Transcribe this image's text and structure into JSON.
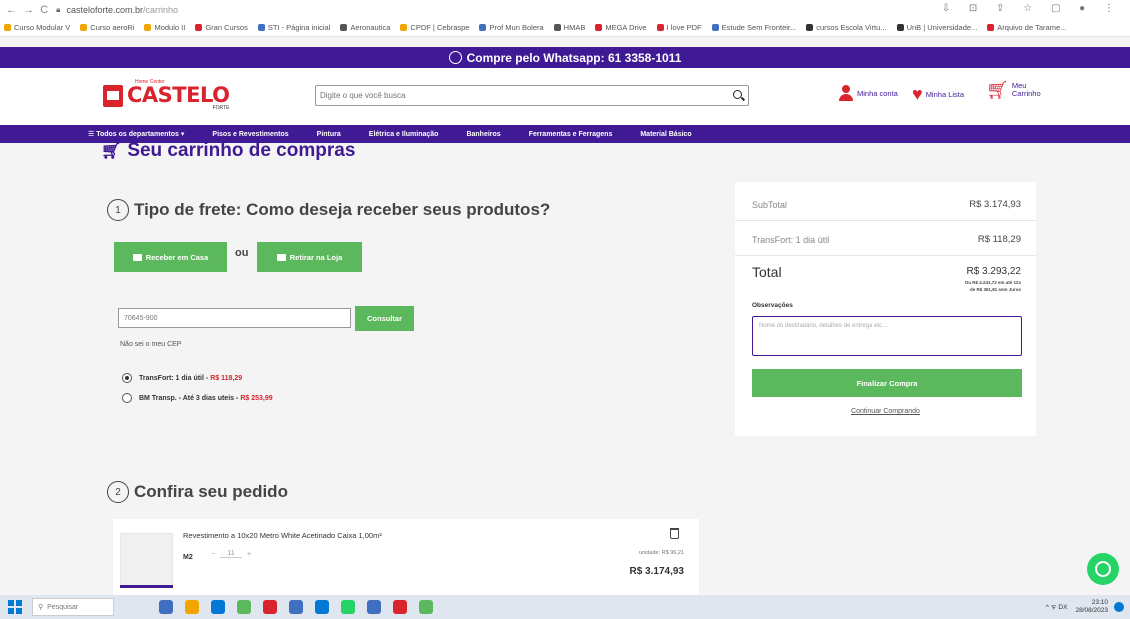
{
  "browser": {
    "url_host": "casteloforte.com.br",
    "url_path": "/carrinho"
  },
  "bookmarks": [
    {
      "label": "Curso Modular V",
      "color": "#f0a500"
    },
    {
      "label": "Curso aeroRi",
      "color": "#f0a500"
    },
    {
      "label": "Modulo II",
      "color": "#f0a500"
    },
    {
      "label": "Gran Cursos",
      "color": "#d9232d"
    },
    {
      "label": "STI - Página inicial",
      "color": "#3f6fbf"
    },
    {
      "label": "Aeronautica",
      "color": "#555555"
    },
    {
      "label": "CPDF | Cebraspe",
      "color": "#f0a500"
    },
    {
      "label": "Prof Mun Bolera",
      "color": "#3f6fbf"
    },
    {
      "label": "HMAB",
      "color": "#555555"
    },
    {
      "label": "MEGA Drive",
      "color": "#d9232d"
    },
    {
      "label": "I love PDF",
      "color": "#d9232d"
    },
    {
      "label": "Estude Sem Fronteir...",
      "color": "#3f6fbf"
    },
    {
      "label": "cursos Escola Virtu...",
      "color": "#333333"
    },
    {
      "label": "UnB | Universidade...",
      "color": "#333333"
    },
    {
      "label": "Arquivo de Tarame...",
      "color": "#d9232d"
    }
  ],
  "banner": {
    "text": "Compre pelo Whatsapp: 61 3358-1011"
  },
  "header": {
    "logo_small": "Home Center",
    "logo_main": "CASTELO",
    "logo_sub": "FORTE",
    "search_placeholder": "Digite o que você busca",
    "account": "Minha conta",
    "wishlist": "Minha Lista",
    "cart_line1": "Meu",
    "cart_line2": "Carrinho"
  },
  "nav": [
    "☰ Todos os departamentos  ▾",
    "Pisos e Revestimentos",
    "Pintura",
    "Elétrica e Iluminação",
    "Banheiros",
    "Ferramentas e Ferragens",
    "Material Básico"
  ],
  "page_title": "Seu carrinho de compras",
  "shipping": {
    "step": "1",
    "title": "Tipo de frete: Como deseja receber seus produtos?",
    "home_btn": "Receber em Casa",
    "or": "ou",
    "store_btn": "Retirar na Loja",
    "cep_value": "70645-900",
    "consult_btn": "Consultar",
    "unknown_cep": "Não sei o meu CEP",
    "options": [
      {
        "label": "TransFort: 1 dia útil - ",
        "price": "R$ 118,29",
        "selected": true
      },
      {
        "label": "BM Transp. - Até 3 dias uteis - ",
        "price": "R$ 253,99",
        "selected": false
      }
    ]
  },
  "summary": {
    "subtotal_label": "SubTotal",
    "subtotal_value": "R$ 3.174,93",
    "shipping_label": "TransFort: 1 dia útil",
    "shipping_value": "R$ 118,29",
    "total_label": "Total",
    "total_value": "R$ 3.293,22",
    "installment_1": "Ou R$ 4.241,72 em até 12x",
    "installment_2": "de R$ 361,81 sem Juros",
    "notes_label": "Observações",
    "notes_placeholder": "Nome do destinatário, detalhes de entrega etc ...",
    "checkout_btn": "Finalizar Compra",
    "continue_link": "Continuar Comprando"
  },
  "order": {
    "step": "2",
    "title": "Confira seu pedido",
    "item": {
      "name": "Revestimento a 10x20 Metro White Acetinado Caixa 1,00m²",
      "unit": "M2",
      "minus": "−",
      "qty": "11",
      "plus": "+",
      "unit_price": "unidade: R$ 96,21",
      "total": "R$ 3.174,93"
    }
  },
  "taskbar": {
    "search": "Pesquisar",
    "tray": "^ ᯤ DX",
    "time": "23:10",
    "date": "28/08/2023",
    "apps": [
      "#3f6fbf",
      "#f0a500",
      "#0078d4",
      "#5cb85c",
      "#d9232d",
      "#3f6fbf",
      "#0078d4",
      "#25d366",
      "#3f6fbf",
      "#d9232d",
      "#5cb85c"
    ]
  }
}
